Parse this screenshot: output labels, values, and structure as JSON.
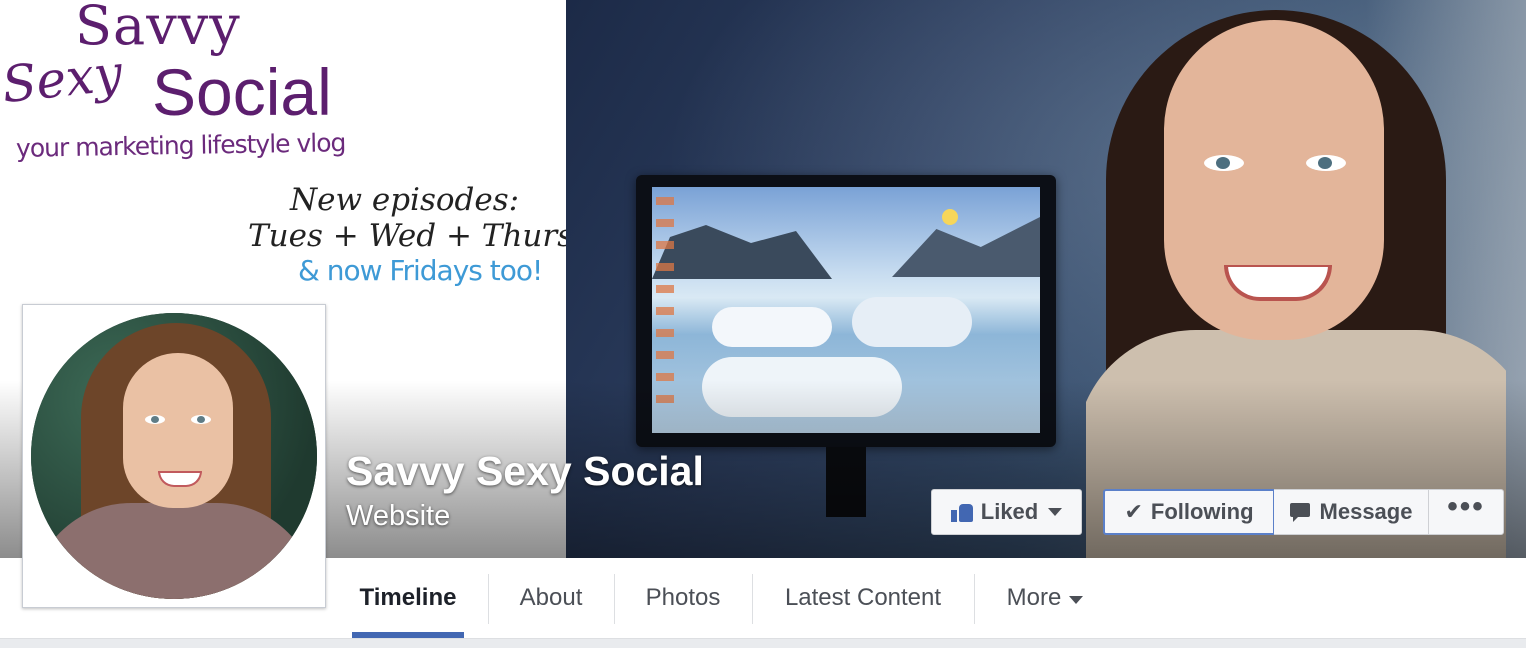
{
  "cover": {
    "brand": {
      "line1": "Savvy",
      "line2": "Sexy",
      "line3": "Social",
      "tagline": "your marketing lifestyle vlog"
    },
    "schedule": {
      "line1": "New episodes:",
      "line2": "Tues + Wed + Thurs",
      "line3": "& now Fridays too!"
    }
  },
  "page": {
    "name": "Savvy Sexy Social",
    "category": "Website"
  },
  "actions": {
    "liked_label": "Liked",
    "following_label": "Following",
    "message_label": "Message",
    "more_label": "•••"
  },
  "tabs": [
    {
      "label": "Timeline",
      "active": true
    },
    {
      "label": "About",
      "active": false
    },
    {
      "label": "Photos",
      "active": false
    },
    {
      "label": "Latest Content",
      "active": false
    },
    {
      "label": "More",
      "active": false
    }
  ],
  "colors": {
    "accent": "#4267b2",
    "brand_purple": "#5c1e6e",
    "schedule_blue": "#3e9ad6"
  },
  "icons": {
    "liked": "thumbs-up-icon",
    "following": "check-icon",
    "message": "message-icon",
    "more": "ellipsis-icon",
    "dropdown": "chevron-down-icon"
  }
}
